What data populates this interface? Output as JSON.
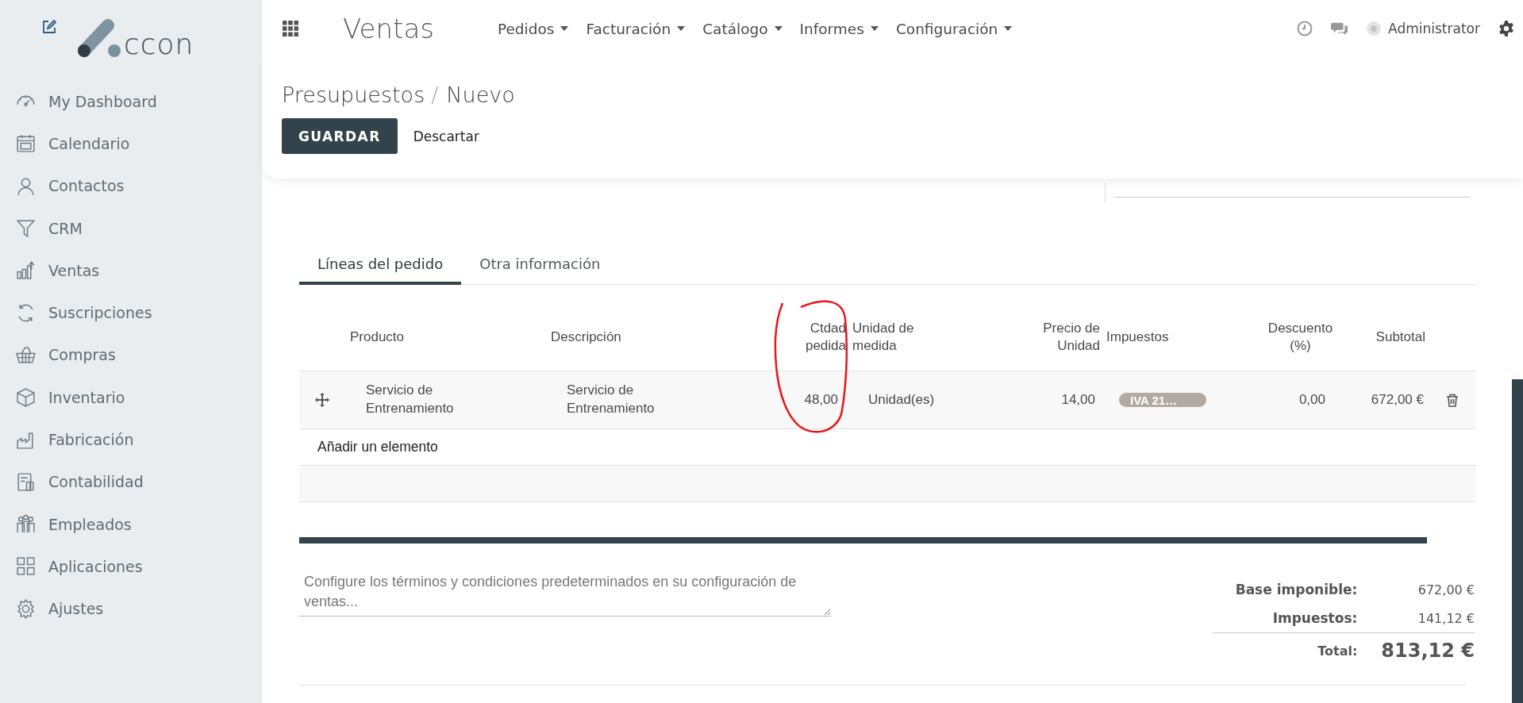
{
  "logo": {
    "text": "ccon"
  },
  "sidebar": {
    "items": [
      {
        "label": "My Dashboard"
      },
      {
        "label": "Calendario"
      },
      {
        "label": "Contactos"
      },
      {
        "label": "CRM"
      },
      {
        "label": "Ventas"
      },
      {
        "label": "Suscripciones"
      },
      {
        "label": "Compras"
      },
      {
        "label": "Inventario"
      },
      {
        "label": "Fabricación"
      },
      {
        "label": "Contabilidad"
      },
      {
        "label": "Empleados"
      },
      {
        "label": "Aplicaciones"
      },
      {
        "label": "Ajustes"
      }
    ]
  },
  "topbar": {
    "app_title": "Ventas",
    "menus": [
      "Pedidos",
      "Facturación",
      "Catálogo",
      "Informes",
      "Configuración"
    ],
    "user": "Administrator"
  },
  "breadcrumb": {
    "items": [
      "Presupuestos",
      "Nuevo"
    ],
    "separator": "/"
  },
  "buttons": {
    "save": "GUARDAR",
    "discard": "Descartar"
  },
  "tabs": [
    {
      "label": "Líneas del pedido",
      "selected": true
    },
    {
      "label": "Otra información",
      "selected": false
    }
  ],
  "table": {
    "columns": [
      "Producto",
      "Descripción",
      "Ctdad pedida",
      "Unidad de medida",
      "Precio de Unidad",
      "Impuestos",
      "Descuento (%)",
      "Subtotal"
    ],
    "rows": [
      {
        "product": "Servicio de Entrenamiento",
        "description": "Servicio de Entrenamiento",
        "quantity": "48,00",
        "unit": "Unidad(es)",
        "price": "14,00",
        "taxes": [
          "IVA 21…"
        ],
        "discount": "0,00",
        "subtotal": "672,00 €"
      }
    ],
    "add_line": "Añadir un elemento"
  },
  "notes": {
    "placeholder": "Configure los términos y condiciones predeterminados en su configuración de ventas..."
  },
  "totals": [
    {
      "kind": "line",
      "label": "Base imponible:",
      "value": "672,00 €"
    },
    {
      "kind": "line",
      "label": "Impuestos:",
      "value": "141,12 €"
    },
    {
      "kind": "grand",
      "label": "Total:",
      "value": "813,12 €"
    }
  ]
}
